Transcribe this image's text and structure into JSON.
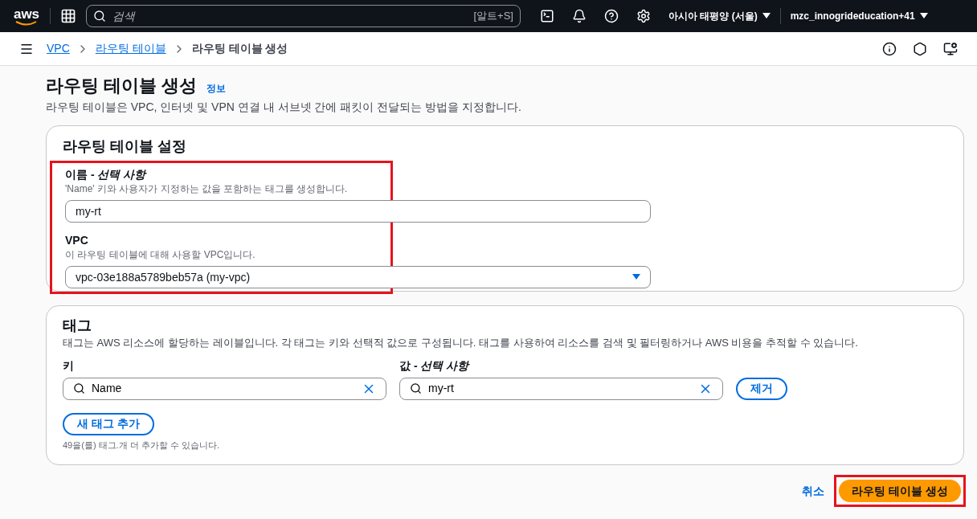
{
  "top_nav": {
    "logo": "aws",
    "search": {
      "placeholder": "검색",
      "shortcut": "[알트+S]"
    },
    "region": "아시아 태평양 (서울)",
    "account": "mzc_innogrideducation+41"
  },
  "breadcrumbs": [
    {
      "label": "VPC",
      "link": true
    },
    {
      "label": "라우팅 테이블",
      "link": true
    },
    {
      "label": "라우팅 테이블 생성",
      "link": false
    }
  ],
  "page": {
    "title": "라우팅 테이블 생성",
    "info_link": "정보",
    "description": "라우팅 테이블은 VPC, 인터넷 및 VPN 연결 내 서브넷 간에 패킷이 전달되는 방법을 지정합니다."
  },
  "settings": {
    "title": "라우팅 테이블 설정",
    "highlighted": true,
    "fields": [
      {
        "kind": "input",
        "label": "이름",
        "label_suffix": "- 선택 사항",
        "hint": "'Name' 키와 사용자가 지정하는 값을 포함하는 태그를 생성합니다.",
        "value": "my-rt"
      },
      {
        "kind": "select",
        "label": "VPC",
        "hint": "이 라우팅 테이블에 대해 사용할 VPC입니다.",
        "value": "vpc-03e188a5789beb57a (my-vpc)"
      }
    ]
  },
  "tags": {
    "title": "태그",
    "description": "태그는 AWS 리소스에 할당하는 레이블입니다. 각 태그는 키와 선택적 값으로 구성됩니다. 태그를 사용하여 리소스를 검색 및 필터링하거나 AWS 비용을 추적할 수 있습니다.",
    "key_label": "키",
    "value_label": "값",
    "value_label_suffix": "- 선택 사항",
    "rows": [
      {
        "key": "Name",
        "value": "my-rt",
        "remove": "제거"
      }
    ],
    "add_button": "새 태그 추가",
    "remaining": "49을(를) 태그.개 더 추가할 수 있습니다."
  },
  "actions": {
    "cancel": "취소",
    "submit": "라우팅 테이블 생성",
    "submit_highlighted": true
  }
}
